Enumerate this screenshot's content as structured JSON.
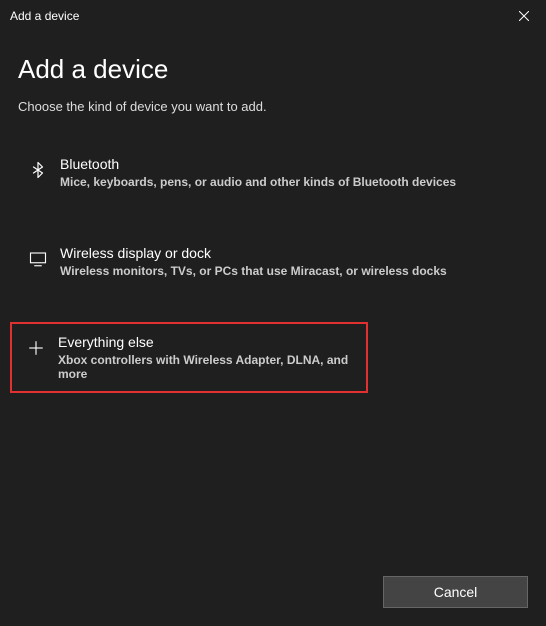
{
  "titlebar": {
    "title": "Add a device"
  },
  "heading": "Add a device",
  "subtext": "Choose the kind of device you want to add.",
  "options": [
    {
      "title": "Bluetooth",
      "desc": "Mice, keyboards, pens, or audio and other kinds of Bluetooth devices"
    },
    {
      "title": "Wireless display or dock",
      "desc": "Wireless monitors, TVs, or PCs that use Miracast, or wireless docks"
    },
    {
      "title": "Everything else",
      "desc": "Xbox controllers with Wireless Adapter, DLNA, and more"
    }
  ],
  "footer": {
    "cancel": "Cancel"
  }
}
